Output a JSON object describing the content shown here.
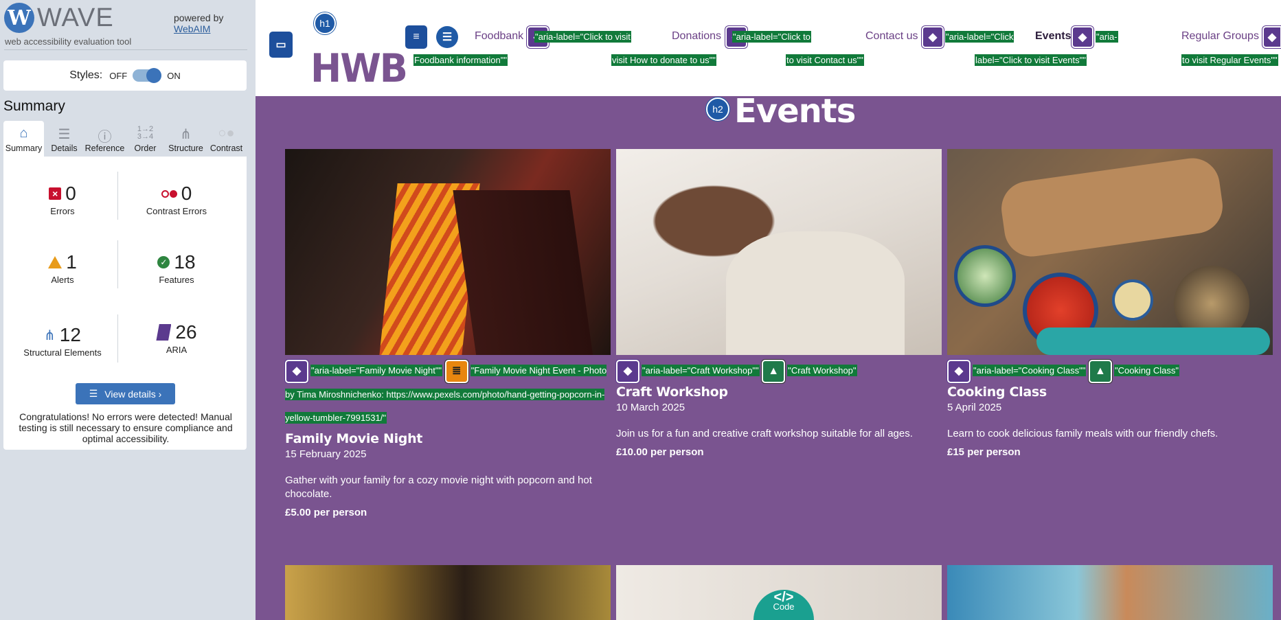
{
  "wave": {
    "logo_letter": "W",
    "logo_word": "WAVE",
    "tagline": "web accessibility evaluation tool",
    "powered_by": "powered by",
    "webaim": "WebAIM",
    "styles_label": "Styles:",
    "styles_off": "OFF",
    "styles_on": "ON",
    "summary_title": "Summary",
    "tabs": [
      {
        "label": "Summary",
        "icon": "home-icon"
      },
      {
        "label": "Details",
        "icon": "list-icon"
      },
      {
        "label": "Reference",
        "icon": "info-icon"
      },
      {
        "label": "Order",
        "icon": "order-icon"
      },
      {
        "label": "Structure",
        "icon": "structure-icon"
      },
      {
        "label": "Contrast",
        "icon": "contrast-icon"
      }
    ],
    "stats": {
      "errors": {
        "value": "0",
        "label": "Errors"
      },
      "contrast_errors": {
        "value": "0",
        "label": "Contrast Errors"
      },
      "alerts": {
        "value": "1",
        "label": "Alerts"
      },
      "features": {
        "value": "18",
        "label": "Features"
      },
      "structural": {
        "value": "12",
        "label": "Structural Elements"
      },
      "aria": {
        "value": "26",
        "label": "ARIA"
      }
    },
    "view_details": "View details ›",
    "congrats": "Congratulations! No errors were detected! Manual testing is still necessary to ensure compliance and optimal accessibility."
  },
  "header": {
    "logo": "HWB",
    "h1_badge": "h1",
    "nav": [
      {
        "label": "Foodbank",
        "aria": "\"aria-label=\"Click to visit",
        "aria2": "Foodbank information\"\""
      },
      {
        "label": "Donations",
        "aria": "\"aria-label=\"Click to",
        "aria2": "visit How to donate to us\"\""
      },
      {
        "label": "Contact us",
        "aria": "\"aria-label=\"Click",
        "aria2": "to visit Contact us\"\""
      },
      {
        "label": "Events",
        "aria": "\"aria-",
        "aria2": "label=\"Click to visit Events\"\""
      },
      {
        "label": "Regular Groups",
        "aria": "",
        "aria2": "to visit Regular Events\"\""
      }
    ]
  },
  "main": {
    "h2_badge": "h2",
    "title": "Events",
    "cards": [
      {
        "aria": "\"aria-label=\"Family Movie Night\"\"",
        "alt": "\"Family Movie Night Event - Photo by Tima Miroshnichenko: https://www.pexels.com/photo/hand-getting-popcorn-in-yellow-tumbler-7991531/\"",
        "title": "Family Movie Night",
        "date": "15 February 2025",
        "desc": "Gather with your family for a cozy movie night with popcorn and hot chocolate.",
        "price": "£5.00 per person"
      },
      {
        "aria": "\"aria-label=\"Craft Workshop\"\"",
        "alt": "\"Craft Workshop\"",
        "title": "Craft Workshop",
        "date": "10 March 2025",
        "desc": "Join us for a fun and creative craft workshop suitable for all ages.",
        "price": "£10.00 per person"
      },
      {
        "aria": "\"aria-label=\"Cooking Class\"\"",
        "alt": "\"Cooking Class\"",
        "title": "Cooking Class",
        "date": "5 April 2025",
        "desc": "Learn to cook delicious family meals with our friendly chefs.",
        "price": "£15 per person"
      }
    ],
    "code_badge": "Code"
  },
  "colors": {
    "accent": "#7a5490",
    "wave_blue": "#3b73b9",
    "highlight": "#117a3a"
  }
}
